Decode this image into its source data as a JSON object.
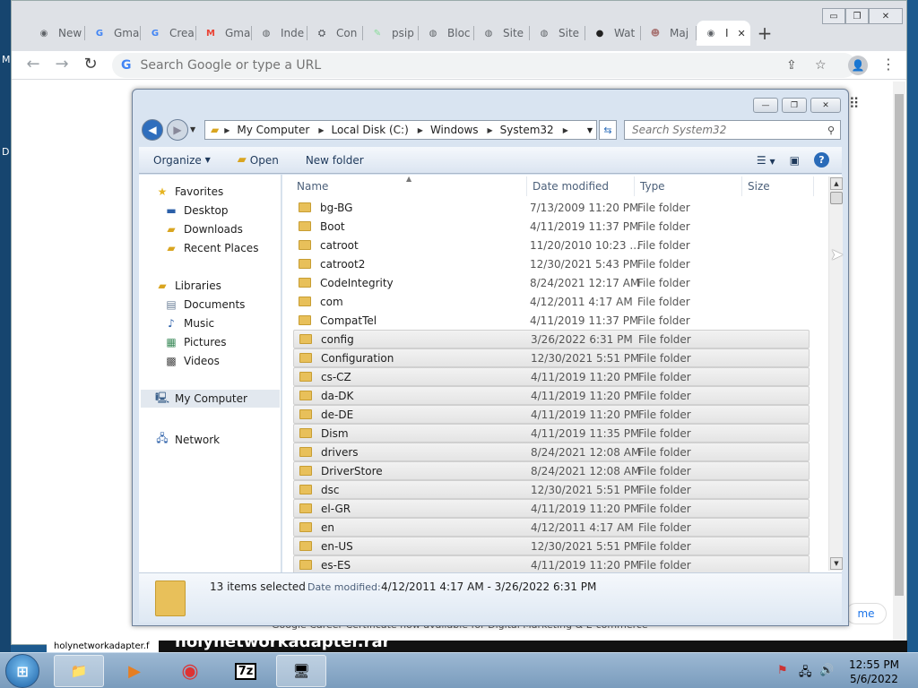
{
  "desktop": {
    "left_letters": [
      "M",
      "D"
    ]
  },
  "chrome": {
    "tabs": [
      {
        "label": "New",
        "icon": "chrome-icon",
        "color": "#5f6368",
        "glyph": "◉"
      },
      {
        "label": "Gma",
        "icon": "google-icon",
        "color": "#4285f4",
        "glyph": "G"
      },
      {
        "label": "Crea",
        "icon": "google-icon",
        "color": "#4285f4",
        "glyph": "G"
      },
      {
        "label": "Gma",
        "icon": "gmail-icon",
        "color": "#ea4335",
        "glyph": "M"
      },
      {
        "label": "Inde",
        "icon": "globe-icon",
        "color": "#5f6368",
        "glyph": "◍"
      },
      {
        "label": "Con",
        "icon": "bug-icon",
        "color": "#5f6368",
        "glyph": "⛭"
      },
      {
        "label": "psip",
        "icon": "page-icon",
        "color": "#8d9",
        "glyph": "✎"
      },
      {
        "label": "Bloc",
        "icon": "globe-icon",
        "color": "#5f6368",
        "glyph": "◍"
      },
      {
        "label": "Site",
        "icon": "globe-icon",
        "color": "#5f6368",
        "glyph": "◍"
      },
      {
        "label": "Site",
        "icon": "globe-icon",
        "color": "#5f6368",
        "glyph": "◍"
      },
      {
        "label": "Wat",
        "icon": "github-icon",
        "color": "#222",
        "glyph": "●"
      },
      {
        "label": "Maj",
        "icon": "avatar-icon",
        "color": "#a77",
        "glyph": "☻"
      },
      {
        "label": "I",
        "icon": "chrome-icon",
        "color": "#5f6368",
        "glyph": "◉"
      }
    ],
    "active_tab_index": 12,
    "tab_close": "✕",
    "new_tab": "+",
    "window_controls": [
      "▭",
      "❐",
      "✕"
    ],
    "nav": {
      "back": "←",
      "forward": "→",
      "reload": "↻"
    },
    "omnibox": {
      "placeholder": "Search Google or type a URL",
      "google_glyph": "G"
    },
    "share": "⇪",
    "bookmark": "☆",
    "profile": "👤",
    "menu": "⋮",
    "apps": "⋮⋮⋮",
    "bg_text": "Google Career Certificate now available for Digital Marketing & E-commerce",
    "bg_button": "me"
  },
  "behind": {
    "file_label": "holynetworkadapter.f",
    "big_text": "holynetworkadapter.rar"
  },
  "explorer": {
    "window_controls": [
      "—",
      "❐",
      "✕"
    ],
    "breadcrumb": [
      "My Computer",
      "Local Disk (C:)",
      "Windows",
      "System32"
    ],
    "search_placeholder": "Search System32",
    "commands": {
      "organize": "Organize",
      "open": "Open",
      "new_folder": "New folder"
    },
    "help": "?",
    "nav": {
      "favorites": "Favorites",
      "fav_items": [
        "Desktop",
        "Downloads",
        "Recent Places"
      ],
      "libraries": "Libraries",
      "lib_items": [
        "Documents",
        "Music",
        "Pictures",
        "Videos"
      ],
      "computer": "My Computer",
      "network": "Network"
    },
    "columns": {
      "name": "Name",
      "date": "Date modified",
      "type": "Type",
      "size": "Size"
    },
    "rows": [
      {
        "name": "bg-BG",
        "date": "7/13/2009 11:20 PM",
        "type": "File folder",
        "selected": false
      },
      {
        "name": "Boot",
        "date": "4/11/2019 11:37 PM",
        "type": "File folder",
        "selected": false
      },
      {
        "name": "catroot",
        "date": "11/20/2010 10:23 ...",
        "type": "File folder",
        "selected": false
      },
      {
        "name": "catroot2",
        "date": "12/30/2021 5:43 PM",
        "type": "File folder",
        "selected": false
      },
      {
        "name": "CodeIntegrity",
        "date": "8/24/2021 12:17 AM",
        "type": "File folder",
        "selected": false
      },
      {
        "name": "com",
        "date": "4/12/2011 4:17 AM",
        "type": "File folder",
        "selected": false
      },
      {
        "name": "CompatTel",
        "date": "4/11/2019 11:37 PM",
        "type": "File folder",
        "selected": false
      },
      {
        "name": "config",
        "date": "3/26/2022 6:31 PM",
        "type": "File folder",
        "selected": true
      },
      {
        "name": "Configuration",
        "date": "12/30/2021 5:51 PM",
        "type": "File folder",
        "selected": true
      },
      {
        "name": "cs-CZ",
        "date": "4/11/2019 11:20 PM",
        "type": "File folder",
        "selected": true
      },
      {
        "name": "da-DK",
        "date": "4/11/2019 11:20 PM",
        "type": "File folder",
        "selected": true
      },
      {
        "name": "de-DE",
        "date": "4/11/2019 11:20 PM",
        "type": "File folder",
        "selected": true
      },
      {
        "name": "Dism",
        "date": "4/11/2019 11:35 PM",
        "type": "File folder",
        "selected": true
      },
      {
        "name": "drivers",
        "date": "8/24/2021 12:08 AM",
        "type": "File folder",
        "selected": true
      },
      {
        "name": "DriverStore",
        "date": "8/24/2021 12:08 AM",
        "type": "File folder",
        "selected": true
      },
      {
        "name": "dsc",
        "date": "12/30/2021 5:51 PM",
        "type": "File folder",
        "selected": true
      },
      {
        "name": "el-GR",
        "date": "4/11/2019 11:20 PM",
        "type": "File folder",
        "selected": true
      },
      {
        "name": "en",
        "date": "4/12/2011 4:17 AM",
        "type": "File folder",
        "selected": true
      },
      {
        "name": "en-US",
        "date": "12/30/2021 5:51 PM",
        "type": "File folder",
        "selected": true
      },
      {
        "name": "es-ES",
        "date": "4/11/2019 11:20 PM",
        "type": "File folder",
        "selected": true
      }
    ],
    "details": {
      "count": "13 items selected",
      "date_label": "Date modified:",
      "date_range": "4/12/2011 4:17 AM - 3/26/2022 6:31 PM"
    }
  },
  "taskbar": {
    "start": "⊞",
    "apps": [
      {
        "name": "explorer",
        "glyph": "📁",
        "active": true
      },
      {
        "name": "media-player",
        "glyph": "▶",
        "active": false
      },
      {
        "name": "chrome",
        "glyph": "◉",
        "active": false
      },
      {
        "name": "7zip",
        "glyph": "7z",
        "active": false
      },
      {
        "name": "network-app",
        "glyph": "🖥",
        "active": true
      }
    ],
    "tray": [
      "⚑",
      "🖧",
      "🔊"
    ],
    "time": "12:55 PM",
    "date": "5/6/2022"
  }
}
